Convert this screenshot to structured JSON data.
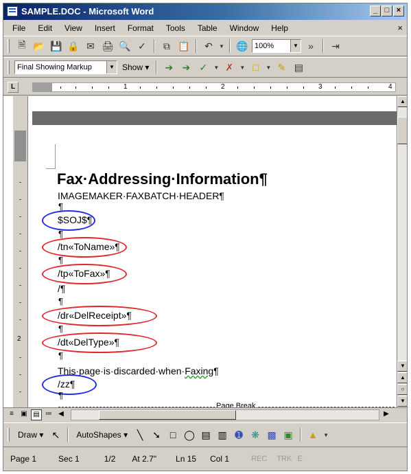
{
  "window": {
    "title": "SAMPLE.DOC - Microsoft Word",
    "buttons": [
      "_",
      "□",
      "×"
    ]
  },
  "menu": [
    "File",
    "Edit",
    "View",
    "Insert",
    "Format",
    "Tools",
    "Table",
    "Window",
    "Help"
  ],
  "menu_close": "×",
  "toolbar_standard": {
    "zoom": "100%",
    "more": "»"
  },
  "toolbar_review": {
    "markup_mode": "Final Showing Markup",
    "show_label": "Show ▾"
  },
  "ruler": {
    "marks": [
      "1",
      "2",
      "3",
      "4"
    ],
    "tab_selector": "L"
  },
  "vruler": {
    "mark": "2"
  },
  "document": {
    "heading": "Fax·Addressing·Information¶",
    "subheading": "IMAGEMAKER·FAXBATCH·HEADER¶",
    "lines": {
      "soj": "$SOJ$¶",
      "toname": "/tn«ToName»¶",
      "tofax": "/tp«ToFax»¶",
      "slash": "/¶",
      "delreceipt": "/dr«DelReceipt»¶",
      "deltype": "/dt«DelType»¶",
      "zz": "/zz¶"
    },
    "pilcrow": "¶",
    "discard_prefix": "This·page·is·discarded·when·",
    "discard_word": "Faxing",
    "discard_suffix": "¶",
    "page_break": "Page Break"
  },
  "drawing": {
    "draw": "Draw ▾",
    "autoshapes": "AutoShapes ▾"
  },
  "status": {
    "page": "Page 1",
    "sec": "Sec 1",
    "pages": "1/2",
    "at": "At 2.7\"",
    "ln": "Ln 15",
    "col": "Col 1",
    "rec": "REC",
    "trk": "TRK",
    "ext": "E"
  },
  "colors": {
    "circle_blue": "#1f2fdd",
    "circle_red": "#e2262b",
    "titlebar": "#0a246a"
  }
}
